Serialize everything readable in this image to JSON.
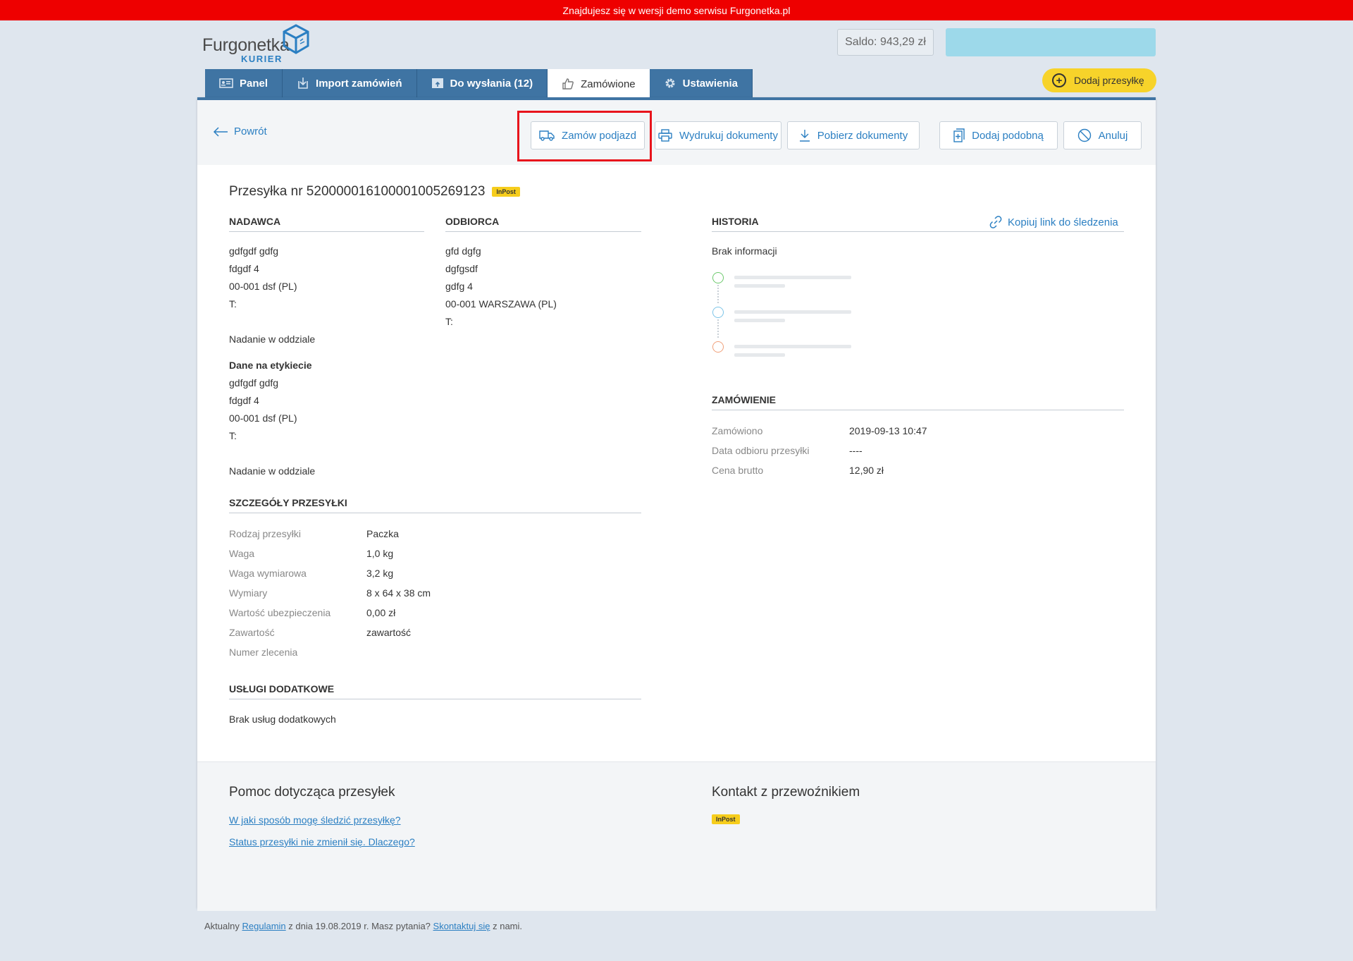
{
  "demo_banner": "Znajdujesz się w wersji demo serwisu Furgonetka.pl",
  "logo": {
    "name": "Furgonetka",
    "sub": "KURIER"
  },
  "header": {
    "saldo": "Saldo: 943,29 zł",
    "add_shipment": "Dodaj przesyłkę"
  },
  "tabs": [
    {
      "label": "Panel",
      "icon": "id-card-icon"
    },
    {
      "label": "Import zamówień",
      "icon": "import-icon"
    },
    {
      "label": "Do wysłania (12)",
      "icon": "box-upload-icon"
    },
    {
      "label": "Zamówione",
      "icon": "thumbs-up-icon",
      "active": true
    },
    {
      "label": "Ustawienia",
      "icon": "gear-icon"
    }
  ],
  "toolbar": {
    "back": "Powrót",
    "buttons": [
      {
        "label": "Zamów podjazd",
        "icon": "truck-icon"
      },
      {
        "label": "Wydrukuj dokumenty",
        "icon": "printer-icon"
      },
      {
        "label": "Pobierz dokumenty",
        "icon": "download-icon"
      },
      {
        "label": "Dodaj podobną",
        "icon": "copy-add-icon"
      },
      {
        "label": "Anuluj",
        "icon": "cancel-icon"
      }
    ]
  },
  "shipment": {
    "title": "Przesyłka nr 520000016100001005269123",
    "carrier_badge": "InPost"
  },
  "sender": {
    "heading": "NADAWCA",
    "lines": [
      "gdfgdf gdfg",
      "fdgdf 4",
      "00-001 dsf (PL)",
      "T:"
    ],
    "pickup": "Nadanie w oddziale",
    "label_heading": "Dane na etykiecie",
    "label_lines": [
      "gdfgdf gdfg",
      "fdgdf 4",
      "00-001 dsf (PL)",
      "T:"
    ],
    "label_pickup": "Nadanie w oddziale"
  },
  "recipient": {
    "heading": "ODBIORCA",
    "lines": [
      "gfd dgfg",
      "dgfgsdf",
      "gdfg 4",
      "00-001 WARSZAWA (PL)",
      "T:"
    ]
  },
  "history": {
    "heading": "HISTORIA",
    "copy_link": "Kopiuj link do śledzenia",
    "empty": "Brak informacji",
    "dot_colors": [
      "#6cc96c",
      "#7cc4e8",
      "#f0a07a"
    ]
  },
  "order": {
    "heading": "ZAMÓWIENIE",
    "rows": [
      {
        "k": "Zamówiono",
        "v": "2019-09-13 10:47"
      },
      {
        "k": "Data odbioru przesyłki",
        "v": "----"
      },
      {
        "k": "Cena brutto",
        "v": "12,90 zł"
      }
    ]
  },
  "details": {
    "heading": "SZCZEGÓŁY PRZESYŁKI",
    "rows": [
      {
        "k": "Rodzaj przesyłki",
        "v": "Paczka"
      },
      {
        "k": "Waga",
        "v": "1,0 kg"
      },
      {
        "k": "Waga wymiarowa",
        "v": "3,2 kg"
      },
      {
        "k": "Wymiary",
        "v": "8 x 64 x 38 cm"
      },
      {
        "k": "Wartość ubezpieczenia",
        "v": "0,00 zł"
      },
      {
        "k": "Zawartość",
        "v": "zawartość"
      },
      {
        "k": "Numer zlecenia",
        "v": ""
      }
    ]
  },
  "extra_services": {
    "heading": "USŁUGI DODATKOWE",
    "text": "Brak usług dodatkowych"
  },
  "help": {
    "title": "Pomoc dotycząca przesyłek",
    "links": [
      "W jaki sposób mogę śledzić przesyłkę?",
      "Status przesyłki nie zmienił się. Dlaczego?"
    ]
  },
  "contact": {
    "title": "Kontakt z przewoźnikiem",
    "badge": "InPost"
  },
  "footer": {
    "prefix": "Aktualny",
    "regulamin": "Regulamin",
    "middle": "z dnia 19.08.2019 r. Masz pytania?",
    "contact_link": "Skontaktuj się",
    "suffix": "z nami."
  },
  "colors": {
    "brand_blue": "#3f74a3",
    "link": "#2b7fc2",
    "accent_yellow": "#f7d32a",
    "demo_red": "#ee0000"
  }
}
